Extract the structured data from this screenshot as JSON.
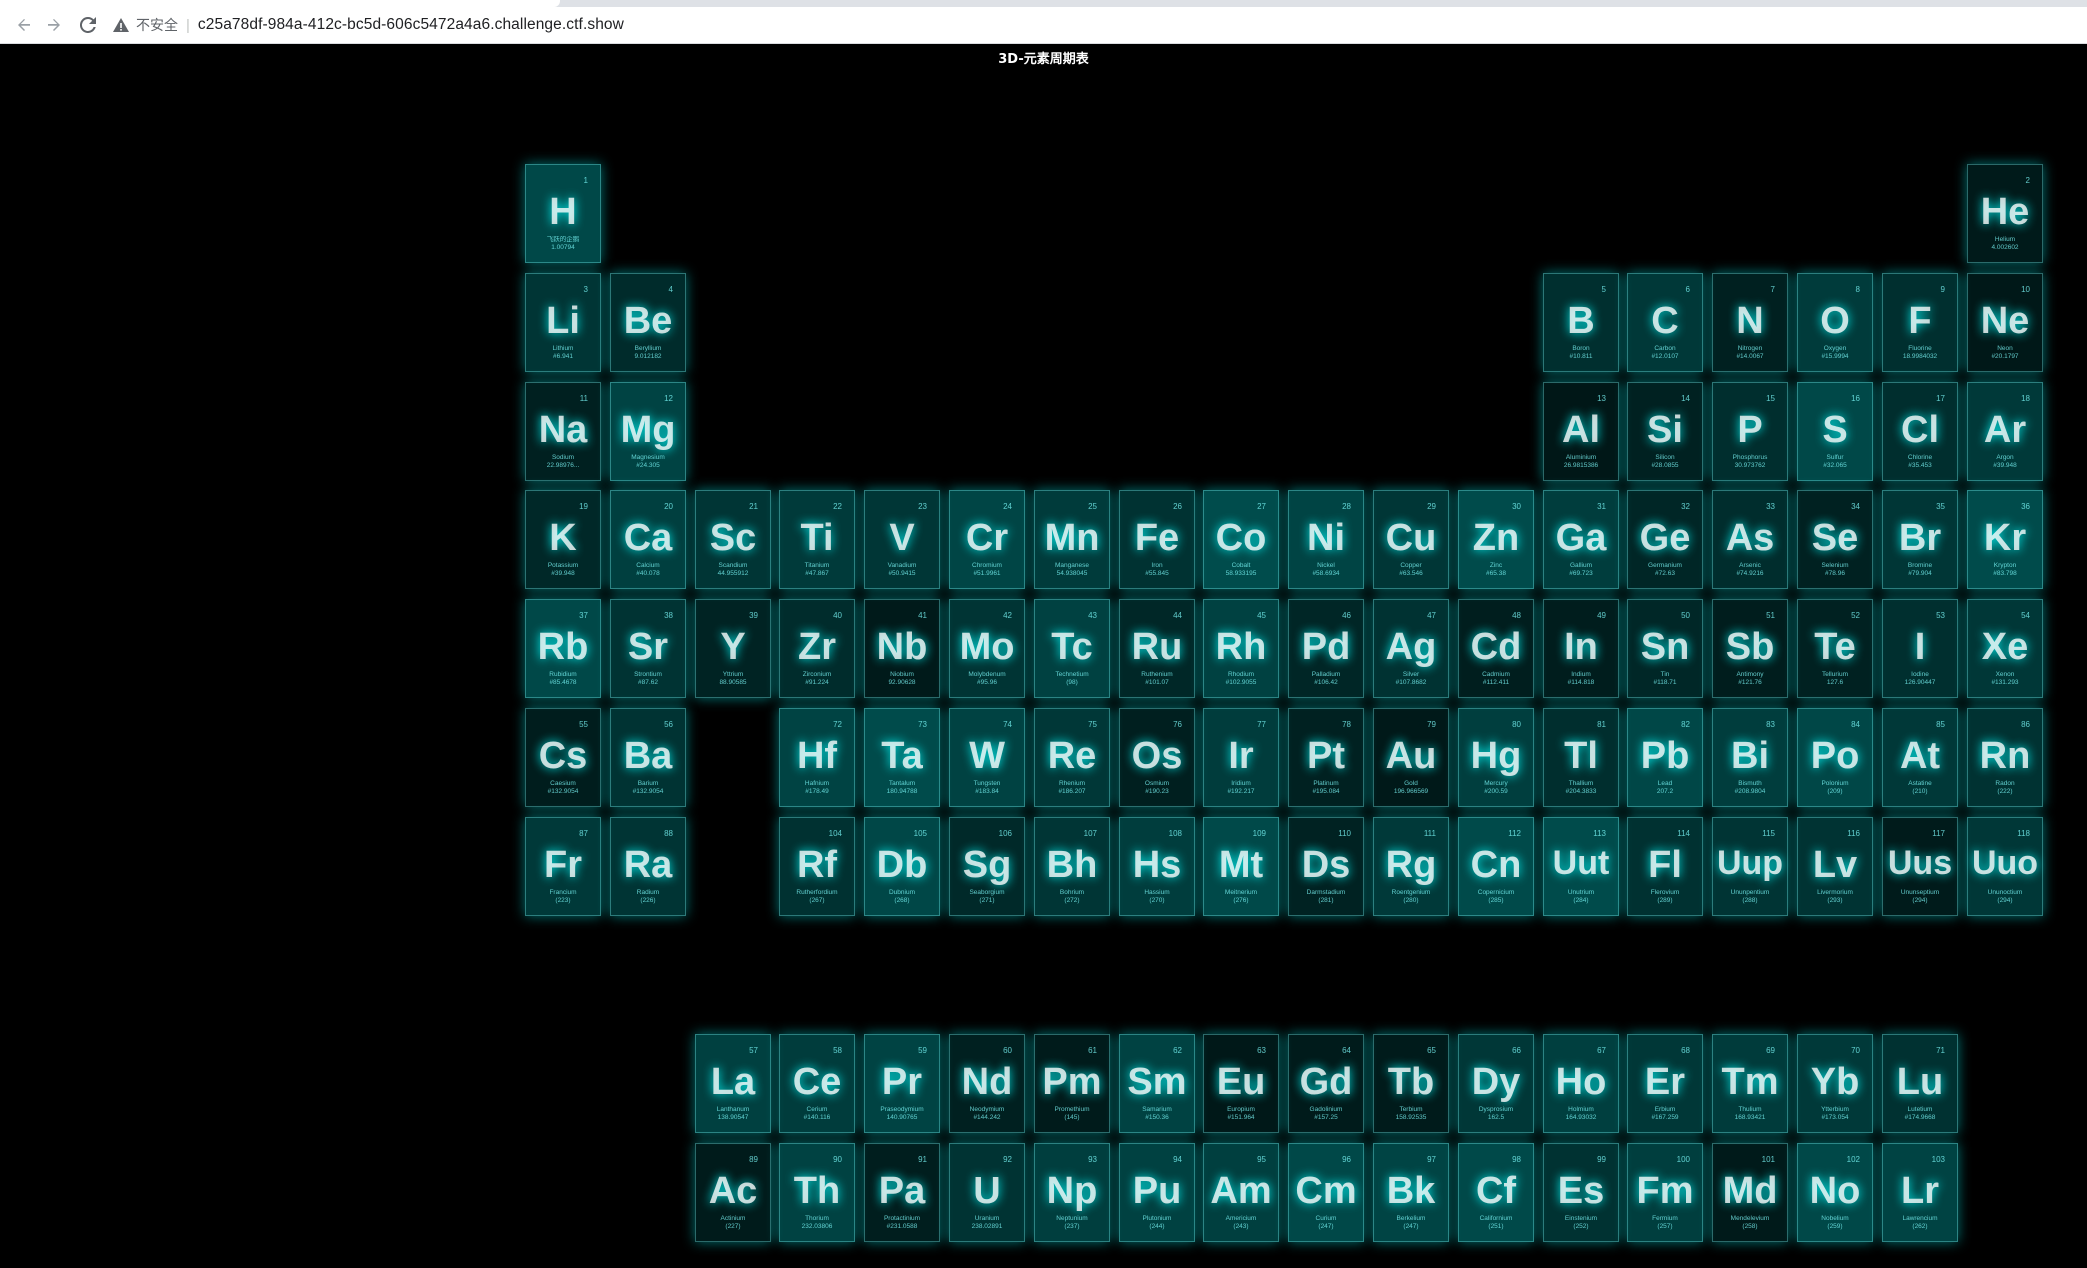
{
  "browser": {
    "security_label": "不安全",
    "url": "c25a78df-984a-412c-bc5d-606c5472a4a6.challenge.ctf.show",
    "back_icon": "arrow-left-icon",
    "forward_icon": "arrow-right-icon",
    "reload_icon": "reload-icon",
    "warning_icon": "warning-triangle-icon"
  },
  "page": {
    "title": "3D-元素周期表"
  },
  "elements": [
    {
      "n": "1",
      "sym": "H",
      "name": "飞跃的企鹅",
      "mass": "1.00794"
    },
    {
      "n": "2",
      "sym": "He",
      "name": "Helium",
      "mass": "4.002602"
    },
    {
      "n": "3",
      "sym": "Li",
      "name": "Lithium",
      "mass": "#6.941"
    },
    {
      "n": "4",
      "sym": "Be",
      "name": "Beryllium",
      "mass": "9.012182"
    },
    {
      "n": "5",
      "sym": "B",
      "name": "Boron",
      "mass": "#10.811"
    },
    {
      "n": "6",
      "sym": "C",
      "name": "Carbon",
      "mass": "#12.0107"
    },
    {
      "n": "7",
      "sym": "N",
      "name": "Nitrogen",
      "mass": "#14.0067"
    },
    {
      "n": "8",
      "sym": "O",
      "name": "Oxygen",
      "mass": "#15.9994"
    },
    {
      "n": "9",
      "sym": "F",
      "name": "Fluorine",
      "mass": "18.9984032"
    },
    {
      "n": "10",
      "sym": "Ne",
      "name": "Neon",
      "mass": "#20.1797"
    },
    {
      "n": "11",
      "sym": "Na",
      "name": "Sodium",
      "mass": "22.98976..."
    },
    {
      "n": "12",
      "sym": "Mg",
      "name": "Magnesium",
      "mass": "#24.305"
    },
    {
      "n": "13",
      "sym": "Al",
      "name": "Aluminium",
      "mass": "26.9815386"
    },
    {
      "n": "14",
      "sym": "Si",
      "name": "Silicon",
      "mass": "#28.0855"
    },
    {
      "n": "15",
      "sym": "P",
      "name": "Phosphorus",
      "mass": "30.973762"
    },
    {
      "n": "16",
      "sym": "S",
      "name": "Sulfur",
      "mass": "#32.065"
    },
    {
      "n": "17",
      "sym": "Cl",
      "name": "Chlorine",
      "mass": "#35.453"
    },
    {
      "n": "18",
      "sym": "Ar",
      "name": "Argon",
      "mass": "#39.948"
    },
    {
      "n": "19",
      "sym": "K",
      "name": "Potassium",
      "mass": "#39.948"
    },
    {
      "n": "20",
      "sym": "Ca",
      "name": "Calcium",
      "mass": "#40.078"
    },
    {
      "n": "21",
      "sym": "Sc",
      "name": "Scandium",
      "mass": "44.955912"
    },
    {
      "n": "22",
      "sym": "Ti",
      "name": "Titanium",
      "mass": "#47.867"
    },
    {
      "n": "23",
      "sym": "V",
      "name": "Vanadium",
      "mass": "#50.9415"
    },
    {
      "n": "24",
      "sym": "Cr",
      "name": "Chromium",
      "mass": "#51.9961"
    },
    {
      "n": "25",
      "sym": "Mn",
      "name": "Manganese",
      "mass": "54.938045"
    },
    {
      "n": "26",
      "sym": "Fe",
      "name": "Iron",
      "mass": "#55.845"
    },
    {
      "n": "27",
      "sym": "Co",
      "name": "Cobalt",
      "mass": "58.933195"
    },
    {
      "n": "28",
      "sym": "Ni",
      "name": "Nickel",
      "mass": "#58.6934"
    },
    {
      "n": "29",
      "sym": "Cu",
      "name": "Copper",
      "mass": "#63.546"
    },
    {
      "n": "30",
      "sym": "Zn",
      "name": "Zinc",
      "mass": "#65.38"
    },
    {
      "n": "31",
      "sym": "Ga",
      "name": "Gallium",
      "mass": "#69.723"
    },
    {
      "n": "32",
      "sym": "Ge",
      "name": "Germanium",
      "mass": "#72.63"
    },
    {
      "n": "33",
      "sym": "As",
      "name": "Arsenic",
      "mass": "#74.9216"
    },
    {
      "n": "34",
      "sym": "Se",
      "name": "Selenium",
      "mass": "#78.96"
    },
    {
      "n": "35",
      "sym": "Br",
      "name": "Bromine",
      "mass": "#79.904"
    },
    {
      "n": "36",
      "sym": "Kr",
      "name": "Krypton",
      "mass": "#83.798"
    },
    {
      "n": "37",
      "sym": "Rb",
      "name": "Rubidium",
      "mass": "#85.4678"
    },
    {
      "n": "38",
      "sym": "Sr",
      "name": "Strontium",
      "mass": "#87.62"
    },
    {
      "n": "39",
      "sym": "Y",
      "name": "Yttrium",
      "mass": "88.90585"
    },
    {
      "n": "40",
      "sym": "Zr",
      "name": "Zirconium",
      "mass": "#91.224"
    },
    {
      "n": "41",
      "sym": "Nb",
      "name": "Niobium",
      "mass": "92.90628"
    },
    {
      "n": "42",
      "sym": "Mo",
      "name": "Molybdenum",
      "mass": "#95.96"
    },
    {
      "n": "43",
      "sym": "Tc",
      "name": "Technetium",
      "mass": "(98)"
    },
    {
      "n": "44",
      "sym": "Ru",
      "name": "Ruthenium",
      "mass": "#101.07"
    },
    {
      "n": "45",
      "sym": "Rh",
      "name": "Rhodium",
      "mass": "#102.9055"
    },
    {
      "n": "46",
      "sym": "Pd",
      "name": "Palladium",
      "mass": "#106.42"
    },
    {
      "n": "47",
      "sym": "Ag",
      "name": "Silver",
      "mass": "#107.8682"
    },
    {
      "n": "48",
      "sym": "Cd",
      "name": "Cadmium",
      "mass": "#112.411"
    },
    {
      "n": "49",
      "sym": "In",
      "name": "Indium",
      "mass": "#114.818"
    },
    {
      "n": "50",
      "sym": "Sn",
      "name": "Tin",
      "mass": "#118.71"
    },
    {
      "n": "51",
      "sym": "Sb",
      "name": "Antimony",
      "mass": "#121.76"
    },
    {
      "n": "52",
      "sym": "Te",
      "name": "Tellurium",
      "mass": "127.6"
    },
    {
      "n": "53",
      "sym": "I",
      "name": "Iodine",
      "mass": "126.90447"
    },
    {
      "n": "54",
      "sym": "Xe",
      "name": "Xenon",
      "mass": "#131.293"
    },
    {
      "n": "55",
      "sym": "Cs",
      "name": "Caesium",
      "mass": "#132.9054"
    },
    {
      "n": "56",
      "sym": "Ba",
      "name": "Barium",
      "mass": "#132.9054"
    },
    {
      "n": "72",
      "sym": "Hf",
      "name": "Hafnium",
      "mass": "#178.49"
    },
    {
      "n": "73",
      "sym": "Ta",
      "name": "Tantalum",
      "mass": "180.94788"
    },
    {
      "n": "74",
      "sym": "W",
      "name": "Tungsten",
      "mass": "#183.84"
    },
    {
      "n": "75",
      "sym": "Re",
      "name": "Rhenium",
      "mass": "#186.207"
    },
    {
      "n": "76",
      "sym": "Os",
      "name": "Osmium",
      "mass": "#190.23"
    },
    {
      "n": "77",
      "sym": "Ir",
      "name": "Iridium",
      "mass": "#192.217"
    },
    {
      "n": "78",
      "sym": "Pt",
      "name": "Platinum",
      "mass": "#195.084"
    },
    {
      "n": "79",
      "sym": "Au",
      "name": "Gold",
      "mass": "196.966569"
    },
    {
      "n": "80",
      "sym": "Hg",
      "name": "Mercury",
      "mass": "#200.59"
    },
    {
      "n": "81",
      "sym": "Tl",
      "name": "Thallium",
      "mass": "#204.3833"
    },
    {
      "n": "82",
      "sym": "Pb",
      "name": "Lead",
      "mass": "207.2"
    },
    {
      "n": "83",
      "sym": "Bi",
      "name": "Bismuth",
      "mass": "#208.9804"
    },
    {
      "n": "84",
      "sym": "Po",
      "name": "Polonium",
      "mass": "(209)"
    },
    {
      "n": "85",
      "sym": "At",
      "name": "Astatine",
      "mass": "(210)"
    },
    {
      "n": "86",
      "sym": "Rn",
      "name": "Radon",
      "mass": "(222)"
    },
    {
      "n": "87",
      "sym": "Fr",
      "name": "Francium",
      "mass": "(223)"
    },
    {
      "n": "88",
      "sym": "Ra",
      "name": "Radium",
      "mass": "(226)"
    },
    {
      "n": "104",
      "sym": "Rf",
      "name": "Rutherfordium",
      "mass": "(267)"
    },
    {
      "n": "105",
      "sym": "Db",
      "name": "Dubnium",
      "mass": "(268)"
    },
    {
      "n": "106",
      "sym": "Sg",
      "name": "Seaborgium",
      "mass": "(271)"
    },
    {
      "n": "107",
      "sym": "Bh",
      "name": "Bohrium",
      "mass": "(272)"
    },
    {
      "n": "108",
      "sym": "Hs",
      "name": "Hassium",
      "mass": "(270)"
    },
    {
      "n": "109",
      "sym": "Mt",
      "name": "Meitnerium",
      "mass": "(276)"
    },
    {
      "n": "110",
      "sym": "Ds",
      "name": "Darmstadium",
      "mass": "(281)"
    },
    {
      "n": "111",
      "sym": "Rg",
      "name": "Roentgenium",
      "mass": "(280)"
    },
    {
      "n": "112",
      "sym": "Cn",
      "name": "Copernicium",
      "mass": "(285)"
    },
    {
      "n": "113",
      "sym": "Uut",
      "name": "Unutrium",
      "mass": "(284)"
    },
    {
      "n": "114",
      "sym": "Fl",
      "name": "Flerovium",
      "mass": "(289)"
    },
    {
      "n": "115",
      "sym": "Uup",
      "name": "Ununpentium",
      "mass": "(288)"
    },
    {
      "n": "116",
      "sym": "Lv",
      "name": "Livermorium",
      "mass": "(293)"
    },
    {
      "n": "117",
      "sym": "Uus",
      "name": "Ununseptium",
      "mass": "(294)"
    },
    {
      "n": "118",
      "sym": "Uuo",
      "name": "Ununoctium",
      "mass": "(294)"
    },
    {
      "n": "57",
      "sym": "La",
      "name": "Lanthanum",
      "mass": "138.90547"
    },
    {
      "n": "58",
      "sym": "Ce",
      "name": "Cerium",
      "mass": "#140.116"
    },
    {
      "n": "59",
      "sym": "Pr",
      "name": "Praseodymium",
      "mass": "140.90765"
    },
    {
      "n": "60",
      "sym": "Nd",
      "name": "Neodymium",
      "mass": "#144.242"
    },
    {
      "n": "61",
      "sym": "Pm",
      "name": "Promethium",
      "mass": "(145)"
    },
    {
      "n": "62",
      "sym": "Sm",
      "name": "Samarium",
      "mass": "#150.36"
    },
    {
      "n": "63",
      "sym": "Eu",
      "name": "Europium",
      "mass": "#151.964"
    },
    {
      "n": "64",
      "sym": "Gd",
      "name": "Gadolinium",
      "mass": "#157.25"
    },
    {
      "n": "65",
      "sym": "Tb",
      "name": "Terbium",
      "mass": "158.92535"
    },
    {
      "n": "66",
      "sym": "Dy",
      "name": "Dysprosium",
      "mass": "162.5"
    },
    {
      "n": "67",
      "sym": "Ho",
      "name": "Holmium",
      "mass": "164.93032"
    },
    {
      "n": "68",
      "sym": "Er",
      "name": "Erbium",
      "mass": "#167.259"
    },
    {
      "n": "69",
      "sym": "Tm",
      "name": "Thulium",
      "mass": "168.93421"
    },
    {
      "n": "70",
      "sym": "Yb",
      "name": "Ytterbium",
      "mass": "#173.054"
    },
    {
      "n": "71",
      "sym": "Lu",
      "name": "Lutetium",
      "mass": "#174.9668"
    },
    {
      "n": "89",
      "sym": "Ac",
      "name": "Actinium",
      "mass": "(227)"
    },
    {
      "n": "90",
      "sym": "Th",
      "name": "Thorium",
      "mass": "232.03806"
    },
    {
      "n": "91",
      "sym": "Pa",
      "name": "Protactinium",
      "mass": "#231.0588"
    },
    {
      "n": "92",
      "sym": "U",
      "name": "Uranium",
      "mass": "238.02891"
    },
    {
      "n": "93",
      "sym": "Np",
      "name": "Neptunium",
      "mass": "(237)"
    },
    {
      "n": "94",
      "sym": "Pu",
      "name": "Plutonium",
      "mass": "(244)"
    },
    {
      "n": "95",
      "sym": "Am",
      "name": "Americium",
      "mass": "(243)"
    },
    {
      "n": "96",
      "sym": "Cm",
      "name": "Curium",
      "mass": "(247)"
    },
    {
      "n": "97",
      "sym": "Bk",
      "name": "Berkelium",
      "mass": "(247)"
    },
    {
      "n": "98",
      "sym": "Cf",
      "name": "Californium",
      "mass": "(251)"
    },
    {
      "n": "99",
      "sym": "Es",
      "name": "Einstenium",
      "mass": "(252)"
    },
    {
      "n": "100",
      "sym": "Fm",
      "name": "Fermium",
      "mass": "(257)"
    },
    {
      "n": "101",
      "sym": "Md",
      "name": "Mendelevium",
      "mass": "(258)"
    },
    {
      "n": "102",
      "sym": "No",
      "name": "Nobelium",
      "mass": "(259)"
    },
    {
      "n": "103",
      "sym": "Lr",
      "name": "Lawrencium",
      "mass": "(262)"
    }
  ]
}
